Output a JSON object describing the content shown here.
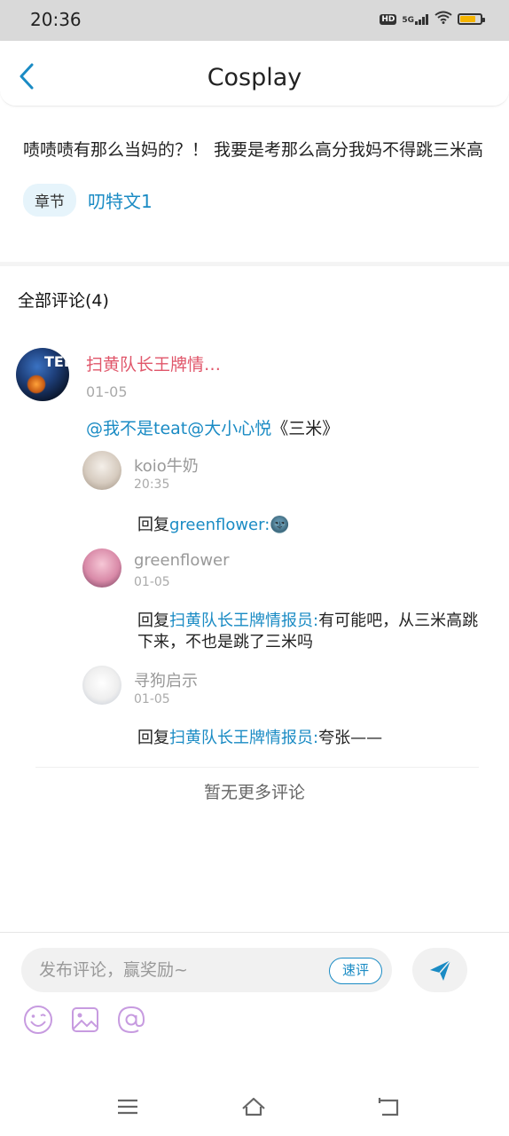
{
  "status_bar": {
    "time": "20:36",
    "hd_label": "HD",
    "network_label": "5G",
    "icons": [
      "hd-icon",
      "5g-signal-icon",
      "wifi-icon",
      "battery-icon"
    ]
  },
  "header": {
    "title": "Cosplay",
    "back_icon": "chevron-left-icon"
  },
  "post": {
    "text": "啧啧啧有那么当妈的？！ 我要是考那么高分我妈不得跳三米高",
    "chapter_tag": "章节",
    "chapter_name": "叨特文1"
  },
  "comments": {
    "header": "全部评论(4)",
    "main": {
      "author": "扫黄队长王牌情…",
      "date": "01-05",
      "mention_text": "@我不是teat@大小心悦",
      "rest_text": "《三米》"
    },
    "replies": [
      {
        "author": "koio牛奶",
        "date": "20:35",
        "prefix": "回复",
        "target": "greenflower",
        "separator": ":",
        "text": "🌚"
      },
      {
        "author": "greenflower",
        "date": "01-05",
        "prefix": "回复",
        "target": "扫黄队长王牌情报员",
        "separator": ":",
        "text": "有可能吧，从三米高跳下来，不也是跳了三米吗"
      },
      {
        "author": "寻狗启示",
        "date": "01-05",
        "prefix": "回复",
        "target": "扫黄队长王牌情报员",
        "separator": ":",
        "text": "夸张——"
      }
    ],
    "no_more": "暂无更多评论"
  },
  "composer": {
    "placeholder": "发布评论，赢奖励~",
    "quick_label": "速评",
    "send_icon": "paper-plane-icon",
    "tools": [
      "emoji-icon",
      "image-icon",
      "at-mention-icon"
    ]
  },
  "system_nav": {
    "icons": [
      "menu-icon",
      "home-icon",
      "back-icon"
    ]
  },
  "colors": {
    "accent": "#1a8bc4",
    "author_highlight": "#e0566a",
    "tool_purple": "#c79be0"
  }
}
